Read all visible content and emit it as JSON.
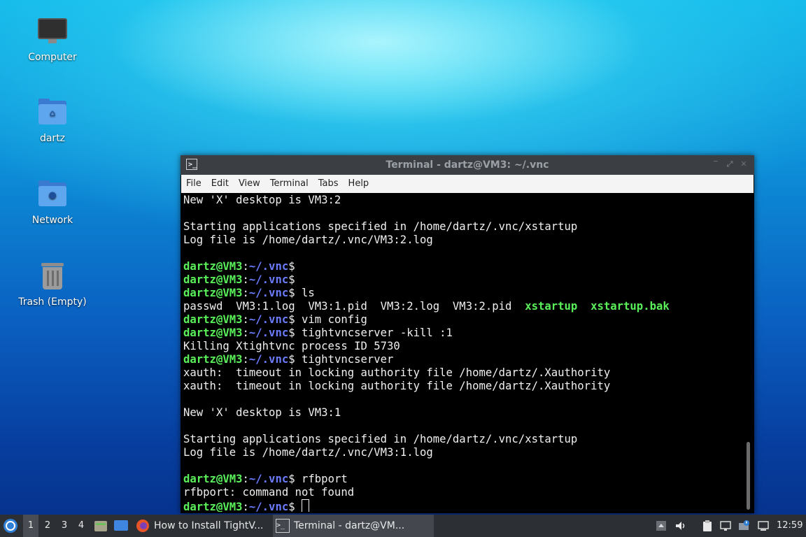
{
  "desktop": {
    "icons": [
      {
        "label": "Computer",
        "icon": "computer-icon"
      },
      {
        "label": "dartz",
        "icon": "home-folder-icon"
      },
      {
        "label": "Network",
        "icon": "network-folder-icon"
      },
      {
        "label": "Trash (Empty)",
        "icon": "trash-icon"
      }
    ]
  },
  "window": {
    "title": "Terminal - dartz@VM3: ~/.vnc",
    "controls": {
      "minimize": "‾",
      "maximize": "⤢",
      "close": "✕"
    },
    "menu": [
      "File",
      "Edit",
      "View",
      "Terminal",
      "Tabs",
      "Help"
    ]
  },
  "terminal": {
    "prompt": {
      "user": "dartz@VM3",
      "colon": ":",
      "path": "~/.vnc",
      "symbol": "$"
    },
    "lines": [
      {
        "type": "out",
        "text": "New 'X' desktop is VM3:2"
      },
      {
        "type": "out",
        "text": ""
      },
      {
        "type": "out",
        "text": "Starting applications specified in /home/dartz/.vnc/xstartup"
      },
      {
        "type": "out",
        "text": "Log file is /home/dartz/.vnc/VM3:2.log"
      },
      {
        "type": "out",
        "text": ""
      },
      {
        "type": "cmd",
        "text": ""
      },
      {
        "type": "cmd",
        "text": ""
      },
      {
        "type": "cmd",
        "text": " ls"
      },
      {
        "type": "ls",
        "plain": "passwd  VM3:1.log  VM3:1.pid  VM3:2.log  VM3:2.pid  ",
        "exec1": "xstartup",
        "sep": "  ",
        "exec2": "xstartup.bak"
      },
      {
        "type": "cmd",
        "text": " vim config"
      },
      {
        "type": "cmd",
        "text": " tightvncserver -kill :1"
      },
      {
        "type": "out",
        "text": "Killing Xtightvnc process ID 5730"
      },
      {
        "type": "cmd",
        "text": " tightvncserver"
      },
      {
        "type": "out",
        "text": "xauth:  timeout in locking authority file /home/dartz/.Xauthority"
      },
      {
        "type": "out",
        "text": "xauth:  timeout in locking authority file /home/dartz/.Xauthority"
      },
      {
        "type": "out",
        "text": ""
      },
      {
        "type": "out",
        "text": "New 'X' desktop is VM3:1"
      },
      {
        "type": "out",
        "text": ""
      },
      {
        "type": "out",
        "text": "Starting applications specified in /home/dartz/.vnc/xstartup"
      },
      {
        "type": "out",
        "text": "Log file is /home/dartz/.vnc/VM3:1.log"
      },
      {
        "type": "out",
        "text": ""
      },
      {
        "type": "cmd",
        "text": " rfbport"
      },
      {
        "type": "out",
        "text": "rfbport: command not found"
      },
      {
        "type": "cmd",
        "text": " ",
        "cursor": true
      }
    ]
  },
  "taskbar": {
    "workspaces": [
      "1",
      "2",
      "3",
      "4"
    ],
    "active_workspace": "1",
    "tasks": [
      {
        "label": "How to Install TightV...",
        "icon": "firefox-icon"
      },
      {
        "label": "Terminal - dartz@VM...",
        "icon": "terminal-icon"
      }
    ],
    "clock": "12:59"
  },
  "colors": {
    "prompt_user": "#5af05a",
    "prompt_path": "#6b7cff",
    "taskbar_bg": "#2c2f33"
  }
}
